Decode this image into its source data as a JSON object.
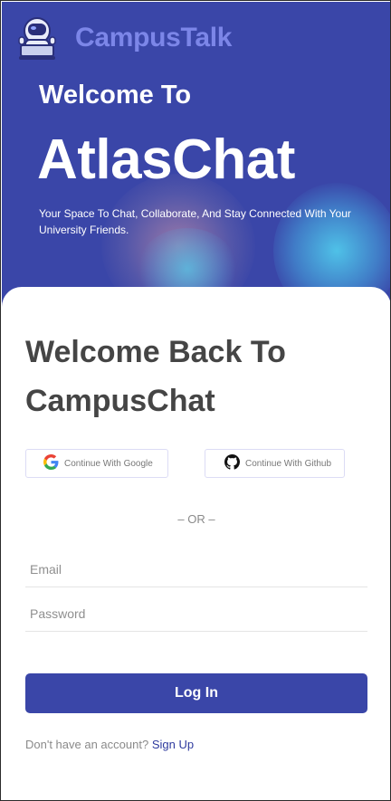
{
  "header": {
    "brand": "CampusTalk",
    "logo_icon": "astronaut-laptop-icon"
  },
  "hero": {
    "welcome_prefix": "Welcome To",
    "title": "AtlasChat",
    "tagline": "Your Space To Chat, Collaborate, And Stay Connected With Your University Friends."
  },
  "login_card": {
    "title": "Welcome Back To CampusChat",
    "google_button": "Continue With Google",
    "github_button": "Continue With Github",
    "divider": "– OR –",
    "email_placeholder": "Email",
    "password_placeholder": "Password",
    "login_button": "Log In",
    "signup_prompt": "Don't have an account?",
    "signup_link": "Sign Up"
  },
  "colors": {
    "primary": "#3a46a8",
    "brand_text": "#7c86e8",
    "heading_text": "#454545",
    "muted_text": "#8a8a8a"
  }
}
